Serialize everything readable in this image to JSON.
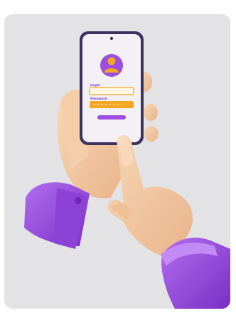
{
  "scene": {
    "background": "#e3e3e5",
    "phone": {
      "login_label": "Login",
      "password_label": "Password",
      "password_mask": "• • • • • • • •",
      "avatar": "user-avatar-icon",
      "colors": {
        "accent_purple": "#9b4ee0",
        "field_orange": "#f5a623",
        "skin": "#f3c9a3",
        "frame": "#3a3360"
      }
    }
  }
}
